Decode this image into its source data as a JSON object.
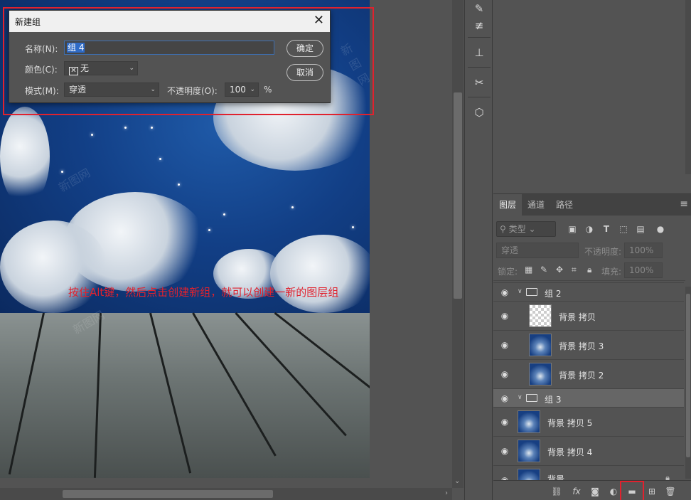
{
  "canvas": {
    "annotation": "按住Alt键，然后点击创建新组，就可以创建一新的图层组",
    "watermark": "新图网"
  },
  "dialog": {
    "title": "新建组",
    "name_label": "名称(N):",
    "name_value": "组 4",
    "color_label": "颜色(C):",
    "color_value": "无",
    "mode_label": "模式(M):",
    "mode_value": "穿透",
    "opacity_label": "不透明度(O):",
    "opacity_value": "100",
    "opacity_unit": "%",
    "ok_label": "确定",
    "cancel_label": "取消"
  },
  "layers_panel": {
    "tabs": [
      "图层",
      "通道",
      "路径"
    ],
    "active_tab": 0,
    "filter_placeholder": "类型",
    "blend_mode": "穿透",
    "opacity_label": "不透明度:",
    "opacity_value": "100%",
    "lock_label": "锁定:",
    "fill_label": "填充:",
    "fill_value": "100%",
    "layers": [
      {
        "name": "组 2",
        "type": "group"
      },
      {
        "name": "背景 拷贝",
        "type": "layer"
      },
      {
        "name": "背景 拷贝 3",
        "type": "layer"
      },
      {
        "name": "背景 拷贝 2",
        "type": "layer"
      },
      {
        "name": "组 3",
        "type": "group"
      },
      {
        "name": "背景 拷贝 5",
        "type": "layer"
      },
      {
        "name": "背景 拷贝 4",
        "type": "layer"
      },
      {
        "name": "背景",
        "type": "layer",
        "locked": true
      }
    ]
  },
  "colors": {
    "highlight": "#e0222e",
    "ui_bg": "#535353",
    "selection": "#2f6bc7"
  }
}
